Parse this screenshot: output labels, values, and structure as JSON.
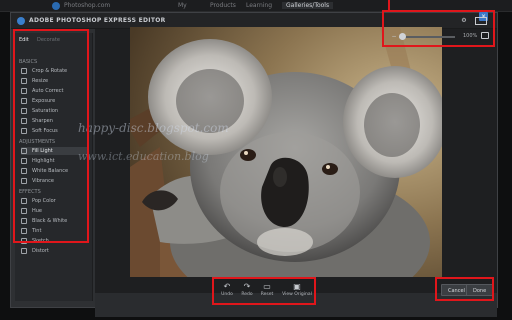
{
  "site": {
    "brand": "Photoshop.com",
    "nav": [
      "My",
      "Products",
      "Learning",
      "Galleries/Tools"
    ]
  },
  "editor": {
    "title": "ADOBE PHOTOSHOP EXPRESS EDITOR",
    "close_label": "×"
  },
  "view_controls": {
    "zoom_label": "100%",
    "zoom_fraction": 0.06
  },
  "panel": {
    "tabs": [
      "Edit",
      "Decorate"
    ],
    "groups": [
      {
        "title": "BASICS",
        "items": [
          "Crop & Rotate",
          "Resize",
          "Auto Correct",
          "Exposure",
          "Saturation",
          "Sharpen",
          "Soft Focus"
        ]
      },
      {
        "title": "ADJUSTMENTS",
        "items": [
          "Fill Light",
          "Highlight",
          "White Balance",
          "Vibrance"
        ]
      },
      {
        "title": "EFFECTS",
        "items": [
          "Pop Color",
          "Hue",
          "Black & White",
          "Tint",
          "Sketch",
          "Distort"
        ]
      }
    ]
  },
  "watermark": {
    "line1": "happy-disc.blogspot.com",
    "line2": "www.ict.education.blog"
  },
  "history": {
    "undo": "Undo",
    "redo": "Redo",
    "reset": "Reset",
    "view_original": "View Original"
  },
  "actions": {
    "cancel": "Cancel",
    "save": "Done"
  },
  "photo": {
    "subject": "koala"
  },
  "colors": {
    "annotation": "#e0161b",
    "accent": "#3c79c9"
  }
}
